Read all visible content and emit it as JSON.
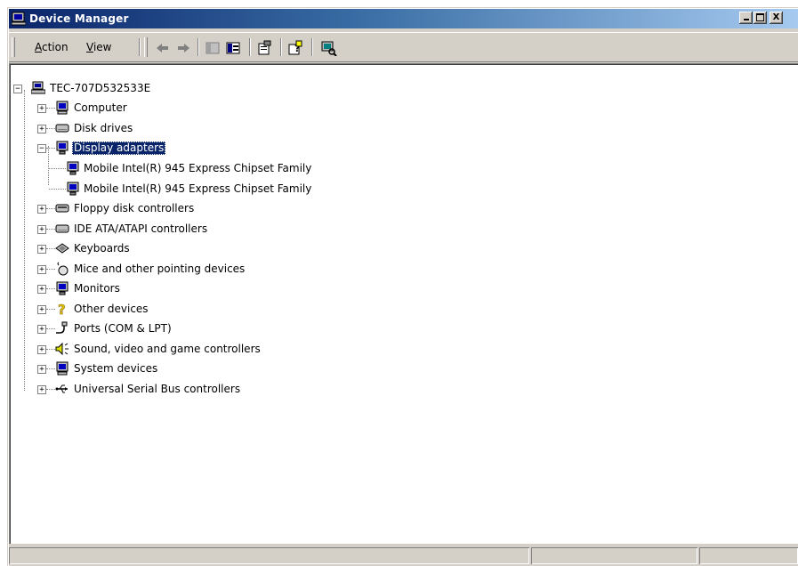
{
  "window": {
    "title": "Device Manager",
    "title_icon": "computer-monitor-icon"
  },
  "titlebar_buttons": {
    "minimize": "_",
    "maximize": "□",
    "close": "X"
  },
  "menu": {
    "action": "Action",
    "view": "View"
  },
  "toolbar": {
    "buttons": [
      "back-arrow-icon",
      "forward-arrow-icon",
      "show-hide-console-tree-icon",
      "export-list-icon",
      "properties-icon",
      "help-icon",
      "scan-hardware-icon"
    ]
  },
  "tree": {
    "root": "TEC-707D532533E",
    "items": [
      {
        "label": "Computer",
        "icon": "computer-icon",
        "expander": "+"
      },
      {
        "label": "Disk drives",
        "icon": "disk-drive-icon",
        "expander": "+"
      },
      {
        "label": "Display adapters",
        "icon": "display-adapter-icon",
        "expander": "−",
        "selected": true,
        "children": [
          {
            "label": "Mobile Intel(R) 945 Express Chipset Family",
            "icon": "display-adapter-icon"
          },
          {
            "label": "Mobile Intel(R) 945 Express Chipset Family",
            "icon": "display-adapter-icon"
          }
        ]
      },
      {
        "label": "Floppy disk controllers",
        "icon": "floppy-controller-icon",
        "expander": "+"
      },
      {
        "label": "IDE ATA/ATAPI controllers",
        "icon": "ide-controller-icon",
        "expander": "+"
      },
      {
        "label": "Keyboards",
        "icon": "keyboard-icon",
        "expander": "+"
      },
      {
        "label": "Mice and other pointing devices",
        "icon": "mouse-icon",
        "expander": "+"
      },
      {
        "label": "Monitors",
        "icon": "monitor-icon",
        "expander": "+"
      },
      {
        "label": "Other devices",
        "icon": "question-mark-icon",
        "expander": "+"
      },
      {
        "label": "Ports (COM & LPT)",
        "icon": "port-icon",
        "expander": "+"
      },
      {
        "label": "Sound, video and game controllers",
        "icon": "speaker-icon",
        "expander": "+"
      },
      {
        "label": "System devices",
        "icon": "system-device-icon",
        "expander": "+"
      },
      {
        "label": "Universal Serial Bus controllers",
        "icon": "usb-icon",
        "expander": "+"
      }
    ]
  },
  "colors": {
    "titlebar_start": "#0a246a",
    "titlebar_end": "#a6caf0",
    "selection": "#0a246a",
    "face": "#d4d0c8"
  }
}
